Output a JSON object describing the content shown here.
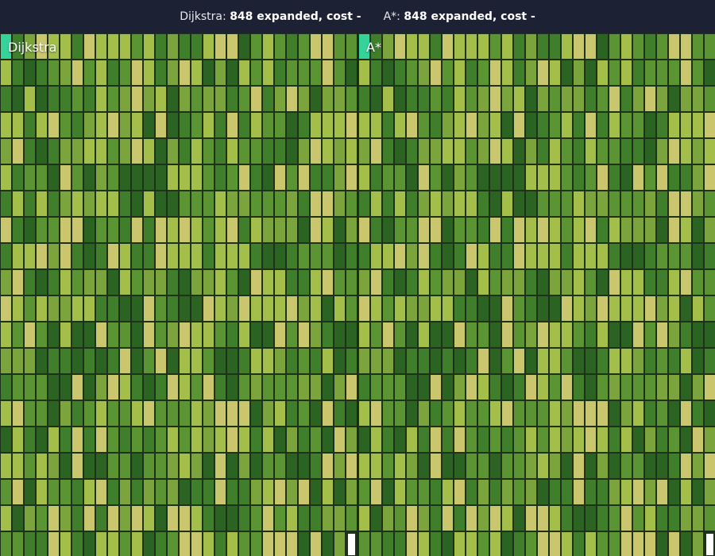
{
  "header": {
    "dijkstra_label": "Dijkstra:",
    "dijkstra_value": "848 expanded, cost -",
    "astar_label": "A*:",
    "astar_value": "848 expanded, cost -"
  },
  "panels": {
    "left_title": "Dijkstra",
    "right_title": "A*"
  },
  "colors": {
    "background": "#1c2233",
    "start": "#35d39a",
    "goal": "#ffffff",
    "terrain": [
      "#2a6322",
      "#3f7f2b",
      "#5b9433",
      "#7ba53c",
      "#a3bf4a",
      "#c9c66e"
    ]
  }
}
